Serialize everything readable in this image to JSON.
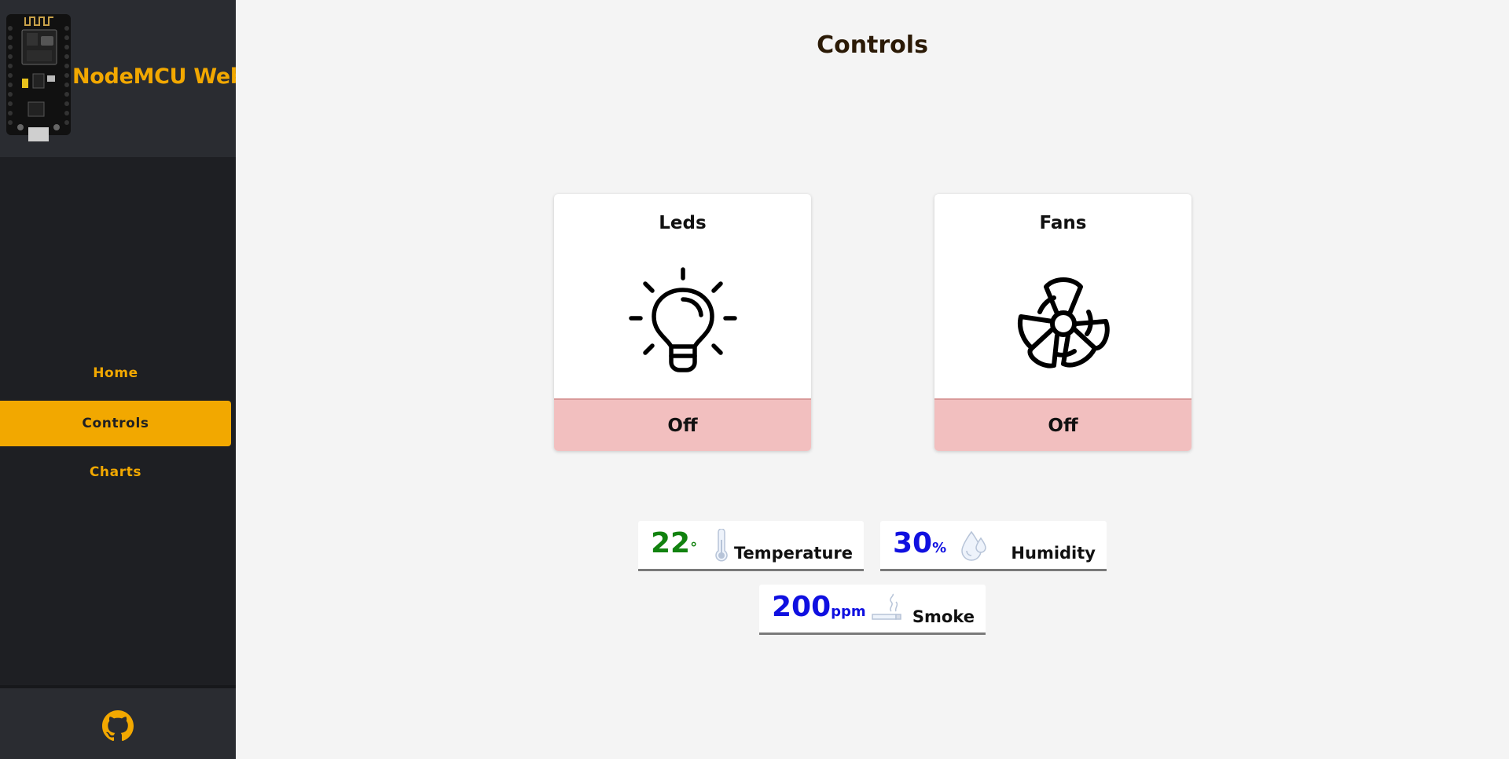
{
  "brand": {
    "title": "NodeMCU Web"
  },
  "nav": {
    "items": [
      {
        "label": "Home"
      },
      {
        "label": "Controls"
      },
      {
        "label": "Charts"
      }
    ],
    "active": "Controls"
  },
  "page": {
    "title": "Controls"
  },
  "controls": [
    {
      "title": "Leds",
      "icon": "lightbulb-icon",
      "state": "Off"
    },
    {
      "title": "Fans",
      "icon": "fan-icon",
      "state": "Off"
    }
  ],
  "sensors": {
    "temperature": {
      "value": "22",
      "unit": "°",
      "label": "Temperature",
      "icon": "thermometer-icon",
      "color": "#11820f"
    },
    "humidity": {
      "value": "30",
      "unit": "%",
      "label": "Humidity",
      "icon": "water-drop-icon",
      "color": "#1010e0"
    },
    "smoke": {
      "value": "200",
      "unit": "ppm",
      "label": "Smoke",
      "icon": "cigarette-icon",
      "color": "#1010e0"
    }
  },
  "colors": {
    "accent": "#f2a800",
    "sidebar": "#1e1f23",
    "toggle_off": "#f2bfbf"
  },
  "footer": {
    "icon": "github-icon"
  }
}
